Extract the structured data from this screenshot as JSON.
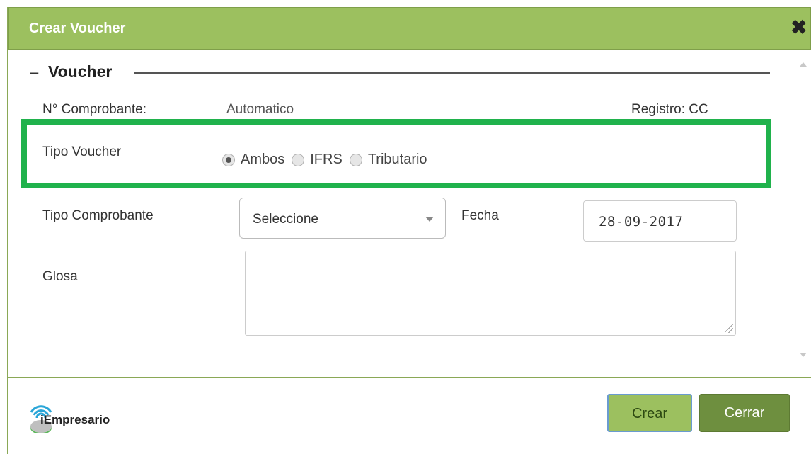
{
  "dialog": {
    "title": "Crear Voucher",
    "close_icon": "close-icon"
  },
  "section": {
    "legend": "Voucher"
  },
  "fields": {
    "comprobante_label": "N° Comprobante:",
    "comprobante_value": "Automatico",
    "registro": "Registro: CC",
    "tipo_voucher_label": "Tipo Voucher",
    "tipo_voucher_options": [
      {
        "label": "Ambos",
        "checked": true
      },
      {
        "label": "IFRS",
        "checked": false
      },
      {
        "label": "Tributario",
        "checked": false
      }
    ],
    "tipo_comprobante_label": "Tipo Comprobante",
    "tipo_comprobante_selected": "Seleccione",
    "fecha_label": "Fecha",
    "fecha_value": "28-09-2017",
    "glosa_label": "Glosa",
    "glosa_value": ""
  },
  "footer": {
    "logo_text": "iEmpresario",
    "crear_label": "Crear",
    "cerrar_label": "Cerrar"
  },
  "colors": {
    "titlebar": "#9cc05f",
    "highlight": "#20b24c",
    "cerrar_button": "#6e8f3f"
  }
}
